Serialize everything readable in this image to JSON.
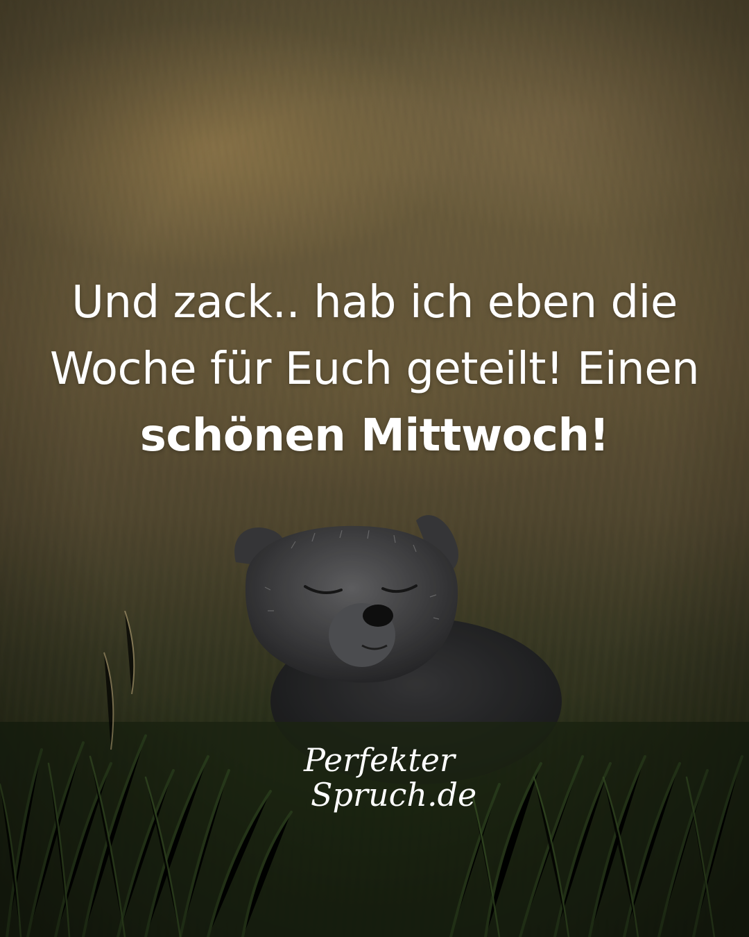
{
  "quote": {
    "line1": "Und zack.. hab ich eben die",
    "line2": "Woche für Euch geteilt! Einen",
    "line3_bold": "schönen Mittwoch!"
  },
  "logo": {
    "line1": "Perfekter",
    "line2": "Spruch.de"
  },
  "colors": {
    "text": "#ffffff",
    "background": "#6f6241",
    "fox_fur": "#4a4a4c"
  }
}
